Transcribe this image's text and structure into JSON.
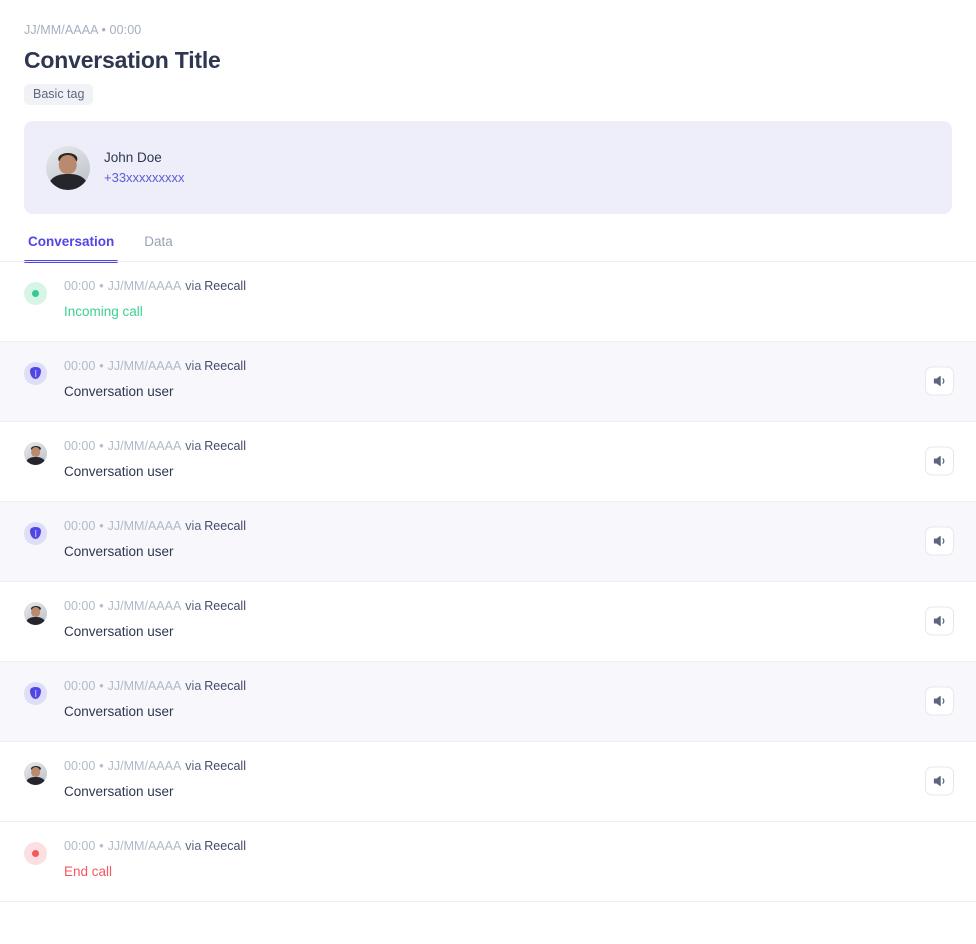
{
  "header": {
    "meta_line": "JJ/MM/AAAA • 00:00",
    "title": "Conversation Title",
    "tag": "Basic tag"
  },
  "contact": {
    "name": "John Doe",
    "phone": "+33xxxxxxxxx",
    "avatar_icon": "user-photo-avatar"
  },
  "tabs": [
    {
      "label": "Conversation",
      "active": true
    },
    {
      "label": "Data",
      "active": false
    }
  ],
  "conversation": {
    "rows": [
      {
        "time": "00:00",
        "separator": "•",
        "date": "JJ/MM/AAAA",
        "via": "via",
        "source": "Reecall",
        "text": "Incoming call",
        "kind": "incoming-call",
        "badge": "green-dot-icon",
        "has_audio": false
      },
      {
        "time": "00:00",
        "separator": "•",
        "date": "JJ/MM/AAAA",
        "via": "via",
        "source": "Reecall",
        "text": "Conversation user",
        "kind": "bot",
        "badge": "bot-shield-icon",
        "has_audio": true
      },
      {
        "time": "00:00",
        "separator": "•",
        "date": "JJ/MM/AAAA",
        "via": "via",
        "source": "Reecall",
        "text": "Conversation user",
        "kind": "user",
        "badge": "user-photo-avatar",
        "has_audio": true
      },
      {
        "time": "00:00",
        "separator": "•",
        "date": "JJ/MM/AAAA",
        "via": "via",
        "source": "Reecall",
        "text": "Conversation user",
        "kind": "bot",
        "badge": "bot-shield-icon",
        "has_audio": true
      },
      {
        "time": "00:00",
        "separator": "•",
        "date": "JJ/MM/AAAA",
        "via": "via",
        "source": "Reecall",
        "text": "Conversation user",
        "kind": "user",
        "badge": "user-photo-avatar",
        "has_audio": true
      },
      {
        "time": "00:00",
        "separator": "•",
        "date": "JJ/MM/AAAA",
        "via": "via",
        "source": "Reecall",
        "text": "Conversation user",
        "kind": "bot",
        "badge": "bot-shield-icon",
        "has_audio": true
      },
      {
        "time": "00:00",
        "separator": "•",
        "date": "JJ/MM/AAAA",
        "via": "via",
        "source": "Reecall",
        "text": "Conversation user",
        "kind": "user",
        "badge": "user-photo-avatar",
        "has_audio": true
      },
      {
        "time": "00:00",
        "separator": "•",
        "date": "JJ/MM/AAAA",
        "via": "via",
        "source": "Reecall",
        "text": "End call",
        "kind": "end-call",
        "badge": "red-dot-icon",
        "has_audio": false
      }
    ],
    "audio_button_icon": "speaker-icon"
  },
  "colors": {
    "accent": "#4f46e5",
    "link": "#5b5bd6",
    "green": "#3ecf8e",
    "red": "#f4585e",
    "row_alt_bg": "#f7f7fc",
    "card_bg": "#eeeefb",
    "title": "#2e3650",
    "muted": "#b2b9ca"
  }
}
